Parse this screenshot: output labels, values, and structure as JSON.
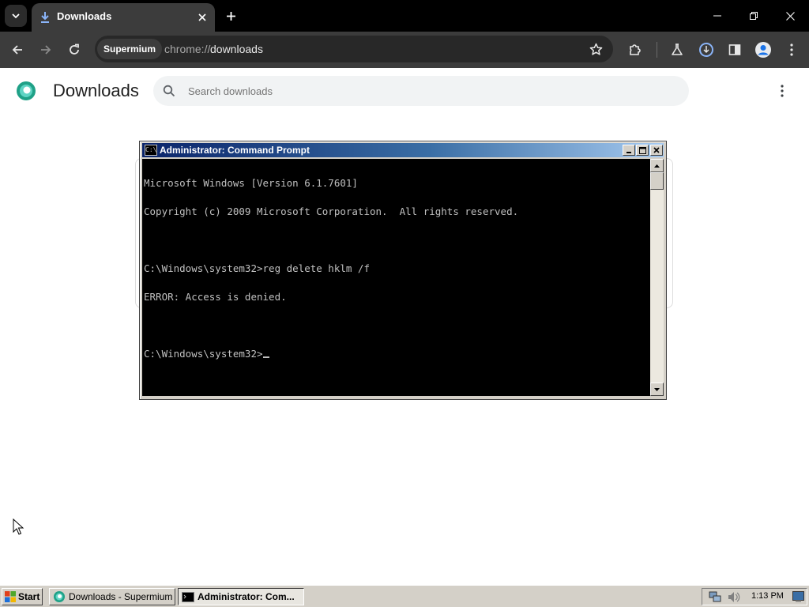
{
  "browser": {
    "tab": {
      "title": "Downloads"
    },
    "omnibox": {
      "site_chip": "Supermium",
      "url_scheme": "chrome://",
      "url_path": "downloads"
    }
  },
  "page": {
    "title": "Downloads",
    "search_placeholder": "Search downloads"
  },
  "cmd": {
    "title": "Administrator: Command Prompt",
    "icon_text": "C:\\",
    "lines": [
      "Microsoft Windows [Version 6.1.7601]",
      "Copyright (c) 2009 Microsoft Corporation.  All rights reserved.",
      "",
      "C:\\Windows\\system32>reg delete hklm /f",
      "ERROR: Access is denied.",
      "",
      "C:\\Windows\\system32>"
    ]
  },
  "taskbar": {
    "start_label": "Start",
    "items": [
      {
        "label": "Downloads - Supermium",
        "active": false
      },
      {
        "label": "Administrator: Com...",
        "active": true
      }
    ],
    "clock": "1:13 PM"
  },
  "colors": {
    "accent_blue": "#1a73e8",
    "console_bg": "#000000",
    "console_fg": "#c0c0c0",
    "titlebar_start": "#0a246a",
    "titlebar_end": "#a6caf0"
  }
}
